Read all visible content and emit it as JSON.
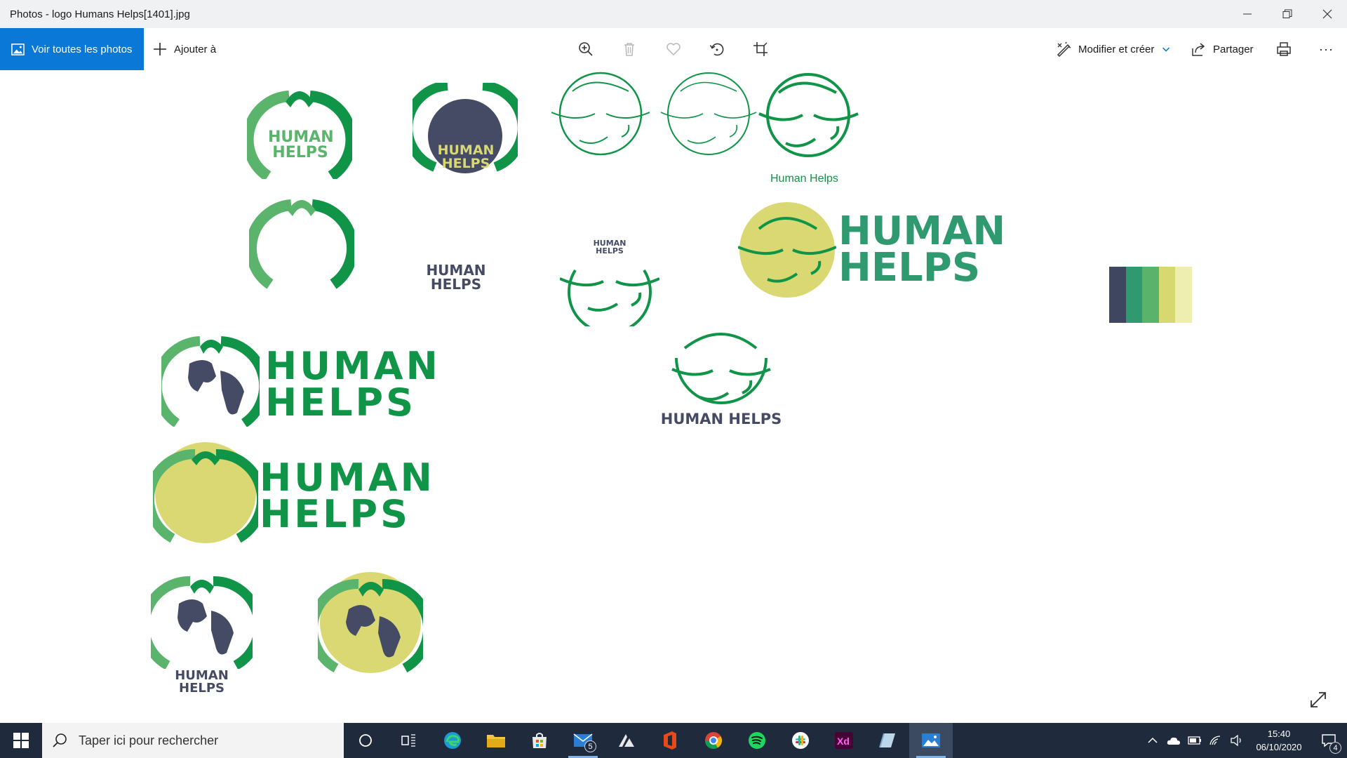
{
  "window": {
    "title": "Photos - logo Humans Helps[1401].jpg",
    "controls": [
      "minimize-icon",
      "restore-icon",
      "close-icon"
    ]
  },
  "toolbar": {
    "view_all_label": "Voir toutes les photos",
    "add_to_label": "Ajouter à",
    "center_tools": [
      "zoom-icon",
      "delete-icon",
      "favorite-icon",
      "rotate-icon",
      "crop-icon"
    ],
    "edit_label": "Modifier et créer",
    "share_label": "Partager",
    "more_label": "···"
  },
  "image": {
    "caption_small": "Human Helps",
    "logo_word_1": "HUMAN",
    "logo_word_2": "HELPS",
    "logo_combined": "HUMAN HELPS",
    "palette": [
      "#3f4660",
      "#2f9a70",
      "#59b36a",
      "#d7d870",
      "#eeeeb0"
    ],
    "colors": {
      "green_dark": "#109447",
      "green_light": "#5ab46b",
      "navy": "#454a65",
      "yellow": "#d9d873"
    }
  },
  "taskbar": {
    "search_placeholder": "Taper ici pour rechercher",
    "mail_badge": "5",
    "time": "15:40",
    "date": "06/10/2020",
    "notification_count": "4"
  }
}
